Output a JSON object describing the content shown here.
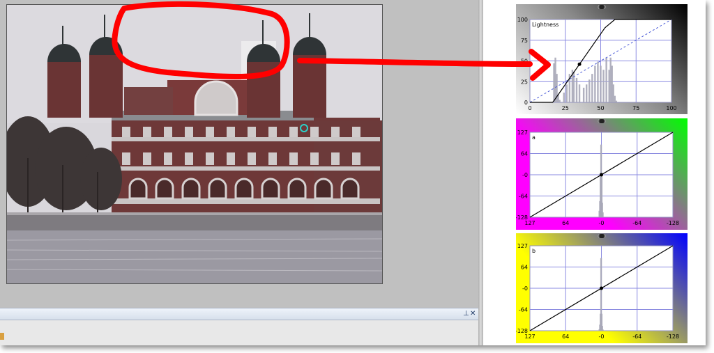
{
  "photo": {
    "sky": "#dcdadf",
    "brick": "#6e3838",
    "stone": "#c9c4c4",
    "water": "#9b99a2",
    "dome": "#2f3436"
  },
  "docked_panel": {
    "pin_icon": "pin-icon",
    "close_icon": "close-icon"
  },
  "annotation": {
    "circle_color": "#ff0000",
    "arrow_color": "#ff0000"
  },
  "curves": {
    "lightness": {
      "label": "Lightness",
      "curve_color": "#000000",
      "chart_data": {
        "type": "line",
        "title": "",
        "x_ticks": [
          "0",
          "25",
          "50",
          "75",
          "100"
        ],
        "y_ticks": [
          "0",
          "25",
          "50",
          "75",
          "100"
        ],
        "xlim": [
          0,
          100
        ],
        "ylim": [
          0,
          100
        ],
        "grid": true,
        "series": [
          {
            "values_x": [
              0,
              16,
              17,
              53,
              60,
              100
            ],
            "values_y": [
              0,
              0,
              2,
              90,
              100,
              100
            ]
          }
        ],
        "reference_line": {
          "x": [
            0,
            100
          ],
          "y": [
            0,
            100
          ],
          "style": "dashed"
        },
        "histogram": {
          "x": [
            17,
            18,
            19,
            20,
            21,
            24,
            26,
            28,
            30,
            31,
            33,
            35,
            38,
            40,
            42,
            44,
            46,
            48,
            50,
            52,
            54,
            56,
            57,
            58,
            59,
            60,
            61
          ],
          "y": [
            48,
            55,
            35,
            10,
            3,
            12,
            22,
            35,
            40,
            38,
            30,
            22,
            18,
            22,
            28,
            35,
            45,
            50,
            45,
            40,
            55,
            40,
            55,
            45,
            22,
            8,
            2
          ]
        }
      }
    },
    "a": {
      "label": "a",
      "chart_data": {
        "type": "line",
        "title": "",
        "x_ticks": [
          "127",
          "64",
          "-0",
          "-64",
          "-128"
        ],
        "y_ticks": [
          "-128",
          "-64",
          "-0",
          "64",
          "127"
        ],
        "xlim": [
          127,
          -128
        ],
        "ylim": [
          127,
          -128
        ],
        "grid": true,
        "series": [
          {
            "values_x": [
              127,
              -128
            ],
            "values_y": [
              127,
              -128
            ]
          }
        ],
        "histogram": {
          "x": [
            3,
            2,
            1,
            0,
            -1,
            -2,
            -3
          ],
          "y": [
            8,
            20,
            55,
            90,
            55,
            18,
            6
          ]
        }
      }
    },
    "b": {
      "label": "b",
      "chart_data": {
        "type": "line",
        "title": "",
        "x_ticks": [
          "127",
          "64",
          "-0",
          "-64",
          "-128"
        ],
        "y_ticks": [
          "-128",
          "-64",
          "-0",
          "64",
          "127"
        ],
        "xlim": [
          127,
          -128
        ],
        "ylim": [
          127,
          -128
        ],
        "grid": true,
        "series": [
          {
            "values_x": [
              127,
              -128
            ],
            "values_y": [
              127,
              -128
            ]
          }
        ],
        "histogram": {
          "x": [
            3,
            2,
            1,
            0,
            -1,
            -2,
            -3
          ],
          "y": [
            6,
            25,
            70,
            300,
            70,
            20,
            5
          ]
        }
      }
    }
  }
}
